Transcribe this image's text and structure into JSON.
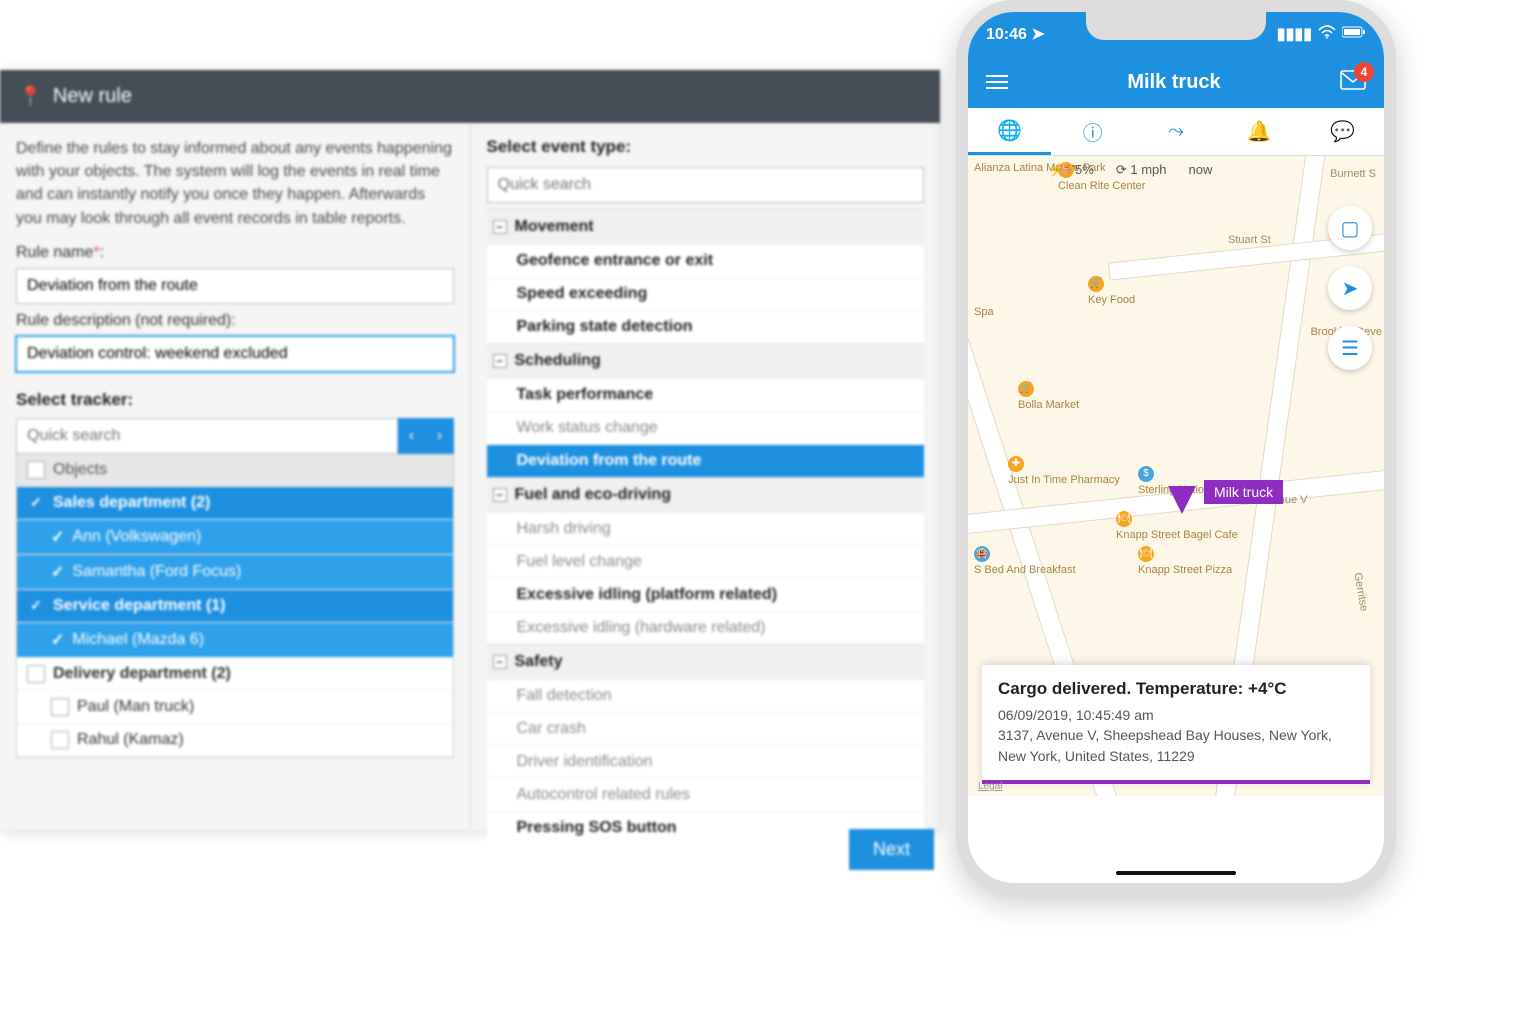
{
  "dialog": {
    "title": "New rule",
    "intro": "Define the rules to stay informed about any events happening with your objects. The system will log the events in real time and can instantly notify you once they happen. Afterwards you may look through all event records in table reports.",
    "rule_name_label": "Rule name",
    "rule_name_value": "Deviation from the route",
    "rule_desc_label": "Rule description (not required):",
    "rule_desc_value": "Deviation control: weekend excluded",
    "select_tracker_label": "Select tracker:",
    "tracker_search_placeholder": "Quick search",
    "trackers": {
      "header": "Objects",
      "groups": [
        {
          "name": "Sales department (2)",
          "checked": true,
          "children": [
            {
              "name": "Ann (Volkswagen)",
              "checked": true
            },
            {
              "name": "Samantha (Ford Focus)",
              "checked": true
            }
          ]
        },
        {
          "name": "Service department (1)",
          "checked": true,
          "children": [
            {
              "name": "Michael (Mazda 6)",
              "checked": true
            }
          ]
        },
        {
          "name": "Delivery department (2)",
          "checked": false,
          "children": [
            {
              "name": "Paul (Man truck)",
              "checked": false
            },
            {
              "name": "Rahul (Kamaz)",
              "checked": false
            }
          ]
        }
      ]
    },
    "event_type_label": "Select event type:",
    "event_search_placeholder": "Quick search",
    "event_groups": [
      {
        "name": "Movement",
        "items": [
          {
            "label": "Geofence entrance or exit",
            "bold": true
          },
          {
            "label": "Speed exceeding",
            "bold": true
          },
          {
            "label": "Parking state detection",
            "bold": true
          }
        ]
      },
      {
        "name": "Scheduling",
        "items": [
          {
            "label": "Task performance",
            "bold": true
          },
          {
            "label": "Work status change",
            "dim": true
          },
          {
            "label": "Deviation from the route",
            "selected": true
          }
        ]
      },
      {
        "name": "Fuel and eco-driving",
        "items": [
          {
            "label": "Harsh driving",
            "dim": true
          },
          {
            "label": "Fuel level change",
            "dim": true
          },
          {
            "label": "Excessive idling (platform related)",
            "bold": true
          },
          {
            "label": "Excessive idling (hardware related)",
            "dim": true
          }
        ]
      },
      {
        "name": "Safety",
        "items": [
          {
            "label": "Fall detection",
            "dim": true
          },
          {
            "label": "Car crash",
            "dim": true
          },
          {
            "label": "Driver identification",
            "dim": true
          },
          {
            "label": "Autocontrol related rules",
            "dim": true
          },
          {
            "label": "Pressing SOS button",
            "bold": true
          }
        ]
      }
    ],
    "next_button": "Next"
  },
  "phone": {
    "status_time": "10:46",
    "app_title": "Milk truck",
    "mail_badge": "4",
    "telemetry": {
      "fuel": "75%",
      "speed": "1 mph",
      "time": "now"
    },
    "marker_label": "Milk truck",
    "pois": [
      "Alianza Latina Marine Park",
      "Clean Rite Center",
      "Spa",
      "Key Food",
      "Bolla Market",
      "Just In Time Pharmacy",
      "S Bed And Breakfast",
      "Sterling National Bank",
      "Knapp Street Bagel Cafe",
      "Knapp Street Pizza",
      "Brooklyn Deve"
    ],
    "streets": [
      "Stuart St",
      "Avenue V",
      "Burnett S",
      "Gerritse"
    ],
    "event": {
      "title": "Cargo delivered. Temperature: +4°C",
      "datetime": "06/09/2019, 10:45:49 am",
      "address": "3137, Avenue V, Sheepshead Bay Houses, New York, New York, United States, 11229"
    },
    "legal": "Legal"
  }
}
